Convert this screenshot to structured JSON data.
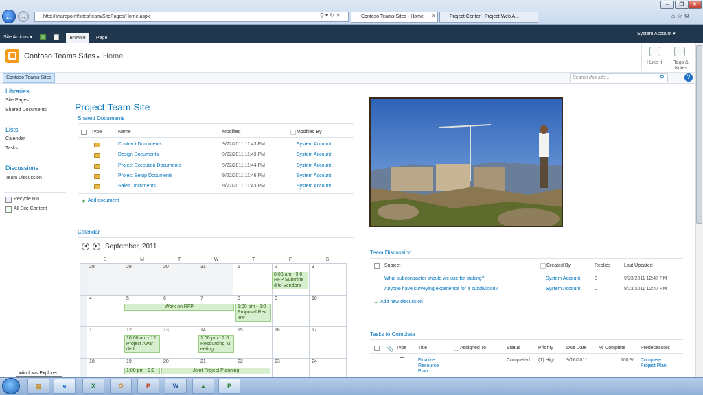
{
  "browser": {
    "url": "http://sharepoint/sites/team/SitePages/Home.aspx",
    "tabs": [
      {
        "label": "Contoso Teams Sites - Home",
        "active": true
      },
      {
        "label": "Project Center - Project Web A...",
        "active": false
      }
    ]
  },
  "ribbon": {
    "site_actions": "Site Actions ▾",
    "tabs": [
      "Browse",
      "Page"
    ],
    "user": "System Account ▾",
    "i_like_it": "I Like It",
    "tags_notes": "Tags & Notes"
  },
  "header": {
    "site_title": "Contoso Teams Sites",
    "separator": "▸",
    "page": "Home"
  },
  "topnav": {
    "item": "Contoso Teams Sites"
  },
  "search": {
    "placeholder": "Search this site..."
  },
  "quicklaunch": {
    "libraries": "Libraries",
    "library_items": [
      "Site Pages",
      "Shared Documents"
    ],
    "lists": "Lists",
    "list_items": [
      "Calendar",
      "Tasks"
    ],
    "discussions": "Discussions",
    "discussion_items": [
      "Team Discussion"
    ],
    "recycle_bin": "Recycle Bin",
    "all_site_content": "All Site Content"
  },
  "page": {
    "title": "Project Team Site"
  },
  "shared_docs": {
    "title": "Shared Documents",
    "columns": {
      "type": "Type",
      "name": "Name",
      "modified": "Modified",
      "modified_by": "Modified By"
    },
    "rows": [
      {
        "name": "Contract Documents",
        "modified": "9/22/2011 11:43 PM",
        "by": "System Account"
      },
      {
        "name": "Design Documents",
        "modified": "9/22/2011 11:43 PM",
        "by": "System Account"
      },
      {
        "name": "Project Execution Documents",
        "modified": "9/22/2011 11:44 PM",
        "by": "System Account"
      },
      {
        "name": "Project Setup Documents",
        "modified": "9/22/2011 11:46 PM",
        "by": "System Account"
      },
      {
        "name": "Sales Documents",
        "modified": "9/22/2011 11:43 PM",
        "by": "System Account"
      }
    ],
    "add": "Add document"
  },
  "calendar": {
    "title": "Calendar",
    "month": "September, 2011",
    "days": [
      "S",
      "M",
      "T",
      "W",
      "T",
      "F",
      "S"
    ],
    "weeks": [
      [
        "28",
        "29",
        "30",
        "31",
        "1",
        "2",
        "3"
      ],
      [
        "4",
        "5",
        "6",
        "7",
        "8",
        "9",
        "10"
      ],
      [
        "11",
        "12",
        "13",
        "14",
        "15",
        "16",
        "17"
      ],
      [
        "18",
        "19",
        "20",
        "21",
        "22",
        "23",
        "24"
      ]
    ],
    "events": {
      "e1": "8:00 am - 9:0",
      "e1b": "RFP Submitte",
      "e1c": "d to Vendors",
      "e2": "Work on RFP",
      "e3": "1:00 pm - 2:0",
      "e3b": "Proposal Rev",
      "e3c": "iew",
      "e4": "10:00 am - 12",
      "e4b": "Project Awar",
      "e4c": "ded",
      "e5": "1:00 pm - 2:0",
      "e5b": "Resourcing M",
      "e5c": "eeting",
      "e6": "1:00 pm - 2:0",
      "e7": "Joint Project Planning"
    }
  },
  "team_discussion": {
    "title": "Team Discussion",
    "columns": {
      "subject": "Subject",
      "created_by": "Created By",
      "replies": "Replies",
      "last_updated": "Last Updated"
    },
    "rows": [
      {
        "subject": "What subcontractor should we use for staking?",
        "by": "System Account",
        "replies": "0",
        "updated": "9/23/2011 12:47 PM"
      },
      {
        "subject": "Anyone have surveying experience for a subdivision?",
        "by": "System Account",
        "replies": "0",
        "updated": "9/23/2011 12:47 PM"
      }
    ],
    "add": "Add new discussion"
  },
  "tasks": {
    "title": "Tasks to Complete",
    "columns": {
      "type": "Type",
      "title": "Title",
      "assigned": "Assigned To",
      "status": "Status",
      "priority": "Priority",
      "due": "Due Date",
      "complete": "% Complete",
      "pred": "Predecessors"
    },
    "row": {
      "title_l1": "Finalize",
      "title_l2": "Resource",
      "title_l3": "Plan",
      "status": "Completed",
      "priority": "(1) High",
      "due": "9/16/2011",
      "complete": "100 %",
      "pred_l1": "Complete",
      "pred_l2": "Project Plan"
    }
  },
  "taskbar": {
    "tooltip": "Windows Explorer"
  }
}
